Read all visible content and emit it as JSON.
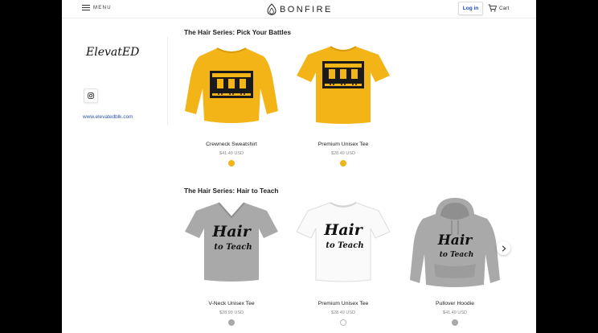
{
  "header": {
    "menu_label": "MENU",
    "logo_text": "BONFIRE",
    "login_label": "Log in",
    "cart_label": "Cart"
  },
  "sidebar": {
    "store_name": "ElevatED",
    "website": "www.elevatedblk.com"
  },
  "sections": [
    {
      "title": "The Hair Series: Pick Your Battles",
      "products": [
        {
          "name": "Crewneck Sweatshirt",
          "price": "$41.49 USD",
          "color": "#f2b416",
          "icon": "sweatshirt-icon"
        },
        {
          "name": "Premium Unisex Tee",
          "price": "$28.49 USD",
          "color": "#f2b416",
          "icon": "tshirt-icon"
        }
      ]
    },
    {
      "title": "The Hair Series: Hair to Teach",
      "products": [
        {
          "name": "V-Neck Unisex Tee",
          "price": "$28.99 USD",
          "color": "#a9a9a9",
          "icon": "tshirt-icon"
        },
        {
          "name": "Premium Unisex Tee",
          "price": "$28.49 USD",
          "color": "#ffffff",
          "icon": "tshirt-icon"
        },
        {
          "name": "Pullover Hoodie",
          "price": "$41.49 USD",
          "color": "#a9a9a9",
          "icon": "hoodie-icon"
        }
      ]
    }
  ],
  "print_text": {
    "design2_line1": "Hair",
    "design2_line2": "to Teach"
  },
  "colors": {
    "gold": "#f2b416",
    "heather": "#a9a9a9",
    "white": "#ffffff",
    "link": "#2a56a8"
  }
}
